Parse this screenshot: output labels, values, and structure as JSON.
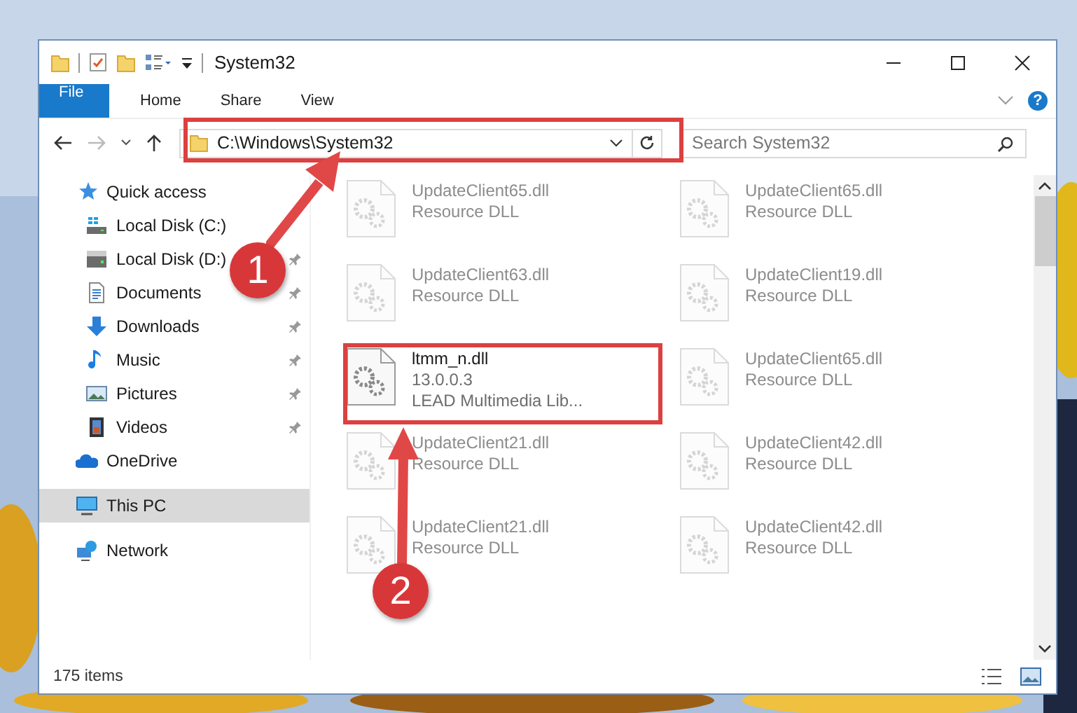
{
  "window": {
    "title": "System32"
  },
  "ribbon": {
    "tabs": [
      {
        "label": "File",
        "kind": "file"
      },
      {
        "label": "Home",
        "kind": "tab"
      },
      {
        "label": "Share",
        "kind": "tab"
      },
      {
        "label": "View",
        "kind": "tab"
      }
    ],
    "help": "?"
  },
  "address": {
    "path": "C:\\Windows\\System32",
    "search_placeholder": "Search System32"
  },
  "sidebar": {
    "items": [
      {
        "label": "Quick access",
        "kind": "star",
        "selected": false,
        "children": [
          {
            "label": "Local Disk (C:)",
            "kind": "drive_win",
            "pinned": false
          },
          {
            "label": "Local Disk (D:)",
            "kind": "drive",
            "pinned": true
          },
          {
            "label": "Documents",
            "kind": "documents",
            "pinned": true
          },
          {
            "label": "Downloads",
            "kind": "downloads",
            "pinned": true
          },
          {
            "label": "Music",
            "kind": "music",
            "pinned": true
          },
          {
            "label": "Pictures",
            "kind": "pictures",
            "pinned": true
          },
          {
            "label": "Videos",
            "kind": "videos",
            "pinned": true
          }
        ]
      },
      {
        "label": "OneDrive",
        "kind": "onedrive",
        "selected": false
      },
      {
        "label": "This PC",
        "kind": "pc",
        "selected": true
      },
      {
        "label": "Network",
        "kind": "network",
        "selected": false
      }
    ]
  },
  "files": [
    {
      "name": "UpdateClient65.dll",
      "details": [
        "Resource DLL"
      ],
      "faded": true
    },
    {
      "name": "UpdateClient65.dll",
      "details": [
        "Resource DLL"
      ],
      "faded": true
    },
    {
      "name": "UpdateClient63.dll",
      "details": [
        "Resource DLL"
      ],
      "faded": true
    },
    {
      "name": "UpdateClient19.dll",
      "details": [
        "Resource DLL"
      ],
      "faded": true
    },
    {
      "name": "ltmm_n.dll",
      "details": [
        "13.0.0.3",
        "LEAD Multimedia Lib..."
      ],
      "faded": false
    },
    {
      "name": "UpdateClient65.dll",
      "details": [
        "Resource DLL"
      ],
      "faded": true
    },
    {
      "name": "UpdateClient21.dll",
      "details": [
        "Resource DLL"
      ],
      "faded": true
    },
    {
      "name": "UpdateClient42.dll",
      "details": [
        "Resource DLL"
      ],
      "faded": true
    },
    {
      "name": "UpdateClient21.dll",
      "details": [
        "Resource DLL"
      ],
      "faded": true
    },
    {
      "name": "UpdateClient42.dll",
      "details": [
        "Resource DLL"
      ],
      "faded": true
    }
  ],
  "status_bar": {
    "count": "175 items"
  },
  "annotations": [
    {
      "number": "1"
    },
    {
      "number": "2"
    }
  ]
}
